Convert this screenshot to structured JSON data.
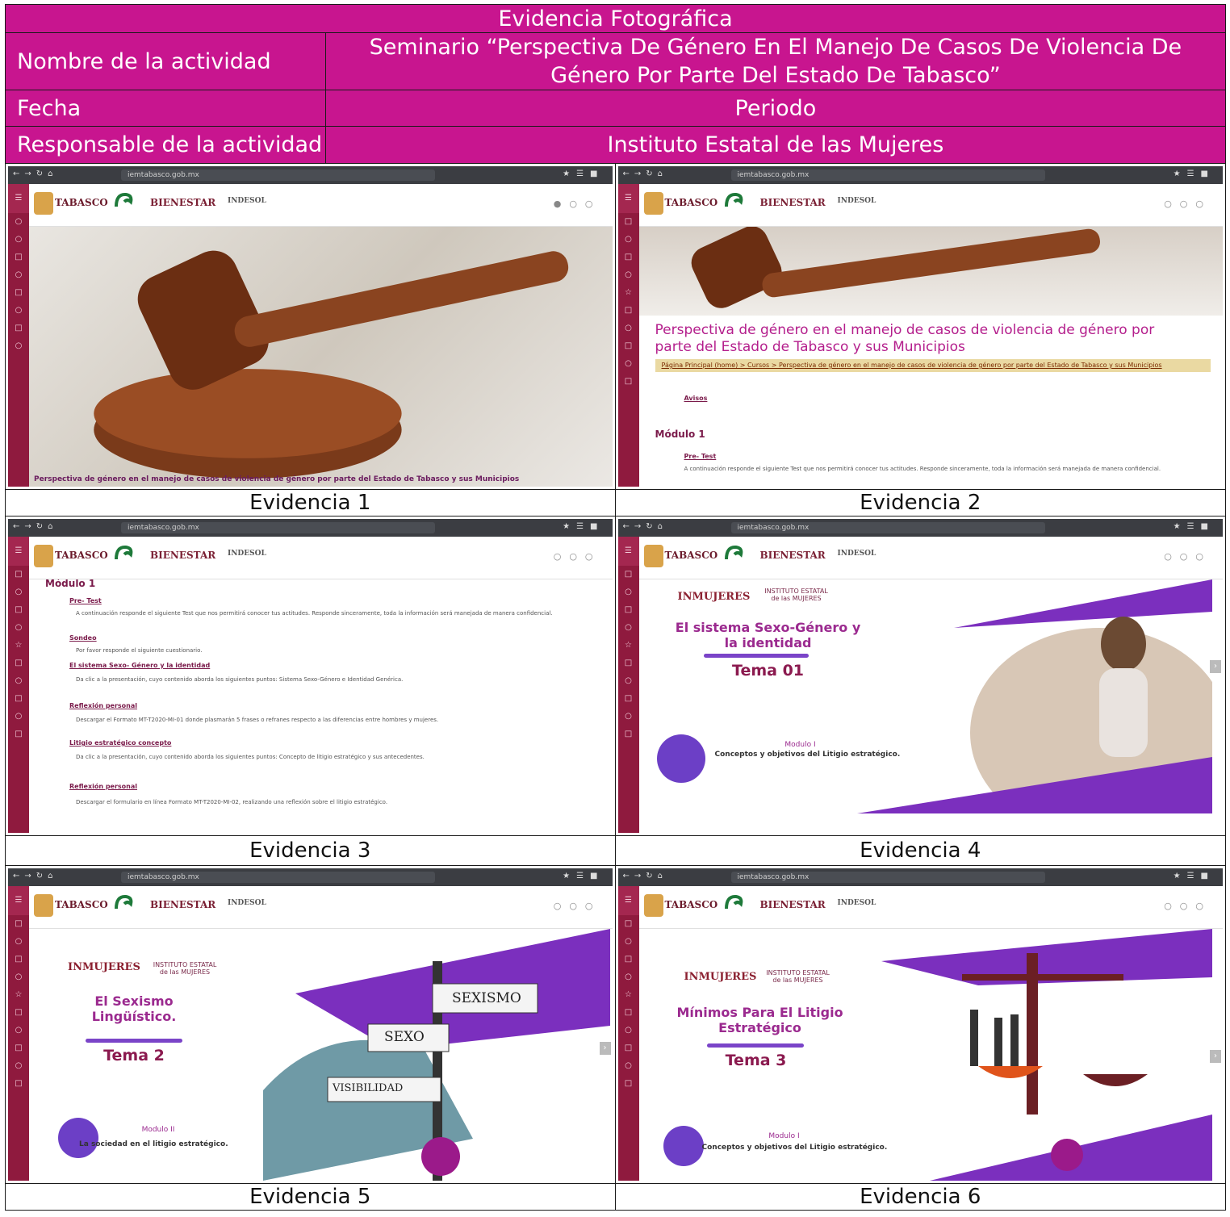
{
  "header": {
    "title": "Evidencia Fotográfica",
    "activity_label": "Nombre de la actividad",
    "activity_value": "Seminario “Perspectiva De Género En El Manejo De Casos De Violencia De Género Por Parte Del Estado De Tabasco”",
    "date_label": "Fecha",
    "date_value": "Periodo",
    "responsible_label": "Responsable de la actividad",
    "responsible_value": "Instituto Estatal de las Mujeres"
  },
  "colors": {
    "header_bg": "#c8158f",
    "sidebar": "#8f1a3e",
    "accent_purple": "#7b2fbe"
  },
  "captions": [
    "Evidencia 1",
    "Evidencia 2",
    "Evidencia 3",
    "Evidencia 4",
    "Evidencia 5",
    "Evidencia 6"
  ],
  "app": {
    "logo_tabasco": "TABASCO",
    "logo_bienestar": "BIENESTAR",
    "logo_indesol": "INDESOL",
    "url_host": "iemtabasco.gob.mx"
  },
  "shot1": {
    "footer": "Perspectiva de género en el manejo de casos de violencia de género por parte del Estado de Tabasco y sus Municipios"
  },
  "shot2": {
    "title": "Perspectiva de género en el manejo de casos de violencia de género por parte del Estado de Tabasco y sus Municipios",
    "breadcrumb": "Página Principal (home) > Cursos > Perspectiva de género en el manejo de casos de violencia de género por parte del Estado de Tabasco y sus Municipios",
    "avisos": "Avisos",
    "modulo": "Módulo 1",
    "pretest": "Pre- Test",
    "pretest_desc": "A continuación responde el siguiente Test que nos permitirá conocer tus actitudes. Responde sinceramente, toda la información será manejada de manera confidencial."
  },
  "shot3": {
    "modulo": "Módulo 1",
    "items": [
      {
        "link": "Pre- Test",
        "desc": "A continuación responde el siguiente Test que nos permitirá conocer tus actitudes. Responde sinceramente, toda la información será manejada de manera confidencial."
      },
      {
        "link": "Sondeo",
        "desc": "Por favor responde el siguiente cuestionario."
      },
      {
        "link": "El sistema Sexo- Género y la identidad",
        "desc": "Da clic a la presentación, cuyo contenido aborda los siguientes puntos: Sistema Sexo-Género e Identidad Genérica."
      },
      {
        "link": "Reflexión personal",
        "desc": "Descargar el Formato MT-T2020-MI-01 donde plasmarán 5 frases o refranes respecto a las diferencias entre hombres y mujeres."
      },
      {
        "link": "Litigio estratégico concepto",
        "desc": "Da clic a la presentación, cuyo contenido aborda los siguientes puntos: Concepto de litigio estratégico y sus antecedentes."
      },
      {
        "link": "Reflexión personal",
        "desc": "Descargar el formulario en línea Formato MT-T2020-MI-02, realizando una reflexión sobre el litigio estratégico."
      }
    ]
  },
  "shot4": {
    "inmujeres": "INMUJERES",
    "ie": "INSTITUTO ESTATAL de las MUJERES",
    "title": "El sistema Sexo-Género y la identidad",
    "tema": "Tema 01",
    "modulo": "Modulo I",
    "subtitle": "Conceptos y objetivos del Litigio estratégico."
  },
  "shot5": {
    "inmujeres": "INMUJERES",
    "ie": "INSTITUTO ESTATAL de las MUJERES",
    "title": "El Sexismo Lingüístico.",
    "tema": "Tema 2",
    "modulo": "Modulo II",
    "subtitle": "La sociedad en el litigio estratégico.",
    "signs": [
      "SEXISMO",
      "SEXO",
      "VISIBILIDAD"
    ]
  },
  "shot6": {
    "inmujeres": "INMUJERES",
    "ie": "INSTITUTO ESTATAL de las MUJERES",
    "title": "Mínimos Para El Litigio Estratégico",
    "tema": "Tema 3",
    "modulo": "Modulo I",
    "subtitle": "Conceptos y objetivos del Litigio estratégico."
  }
}
